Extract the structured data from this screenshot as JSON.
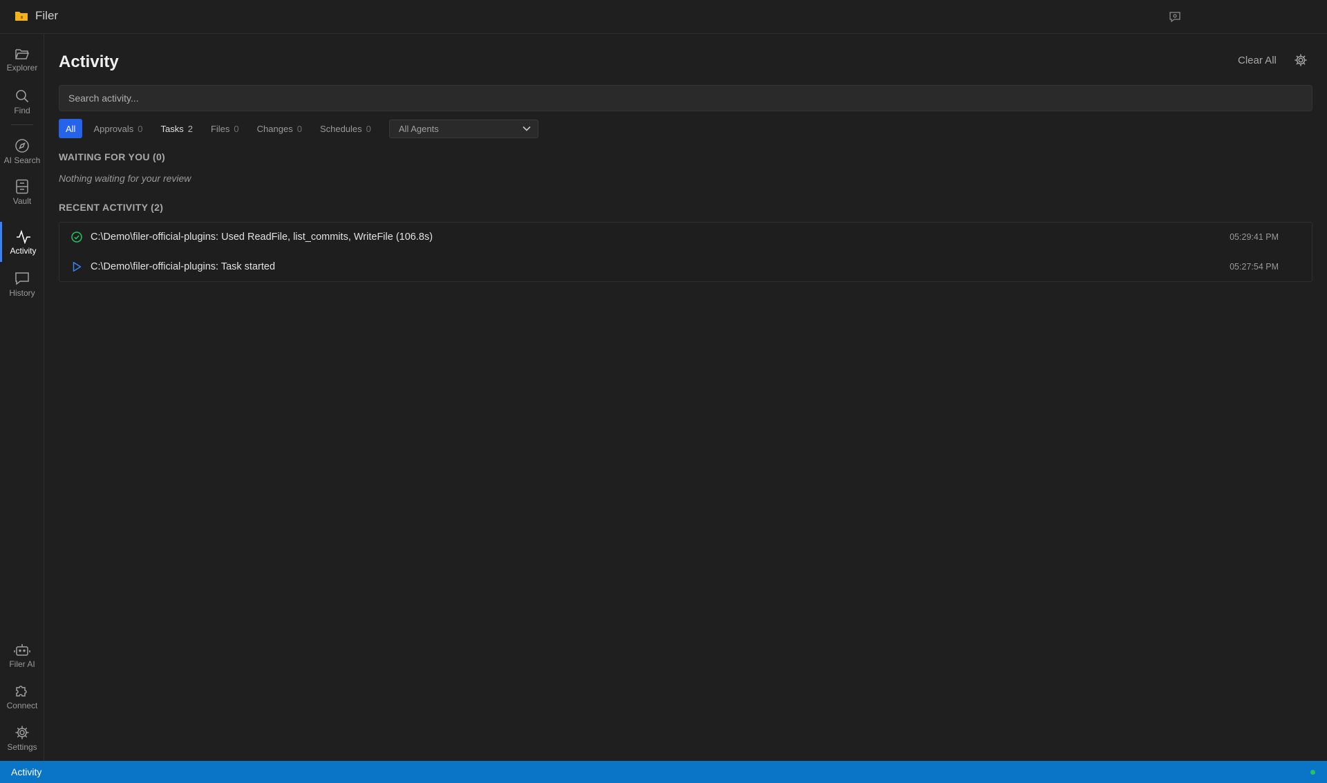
{
  "window": {
    "title": "Filer",
    "logo_icon": "folder-icon",
    "logo_color": "#f2b21a"
  },
  "sidebar": {
    "items": [
      {
        "label": "Explorer",
        "icon": "folder-open-icon"
      },
      {
        "label": "Find",
        "icon": "search-icon"
      },
      {
        "label": "AI Search",
        "icon": "compass-icon"
      },
      {
        "label": "Vault",
        "icon": "archive-icon"
      },
      {
        "label": "Activity",
        "icon": "activity-icon",
        "active": true
      },
      {
        "label": "History",
        "icon": "chat-icon"
      },
      {
        "label": "Filer AI",
        "icon": "robot-icon"
      },
      {
        "label": "Connect",
        "icon": "puzzle-icon"
      },
      {
        "label": "Settings",
        "icon": "gear-icon"
      }
    ]
  },
  "main": {
    "title": "Activity",
    "clear_all": "Clear All",
    "search_placeholder": "Search activity...",
    "filters": [
      {
        "label": "All",
        "active": true
      },
      {
        "label": "Approvals",
        "count": "0"
      },
      {
        "label": "Tasks",
        "count": "2"
      },
      {
        "label": "Files",
        "count": "0"
      },
      {
        "label": "Changes",
        "count": "0"
      },
      {
        "label": "Schedules",
        "count": "0"
      }
    ],
    "agent_select": "All Agents",
    "waiting": {
      "heading": "WAITING FOR YOU (0)",
      "empty": "Nothing waiting for your review"
    },
    "recent": {
      "heading": "RECENT ACTIVITY (2)",
      "items": [
        {
          "text": "C:\\Demo\\filer-official-plugins: Used ReadFile, list_commits, WriteFile (106.8s)",
          "time": "05:29:41 PM",
          "status_icon": "check-circle-icon"
        },
        {
          "text": "C:\\Demo\\filer-official-plugins: Task started",
          "time": "05:27:54 PM",
          "status_icon": "play-icon"
        }
      ]
    }
  },
  "statusbar": {
    "text": "Activity",
    "indicator_color": "#22c55e"
  },
  "colors": {
    "accent": "#2563eb",
    "status_bar": "#0a74c7",
    "success": "#22c55e",
    "play": "#3b82f6"
  }
}
